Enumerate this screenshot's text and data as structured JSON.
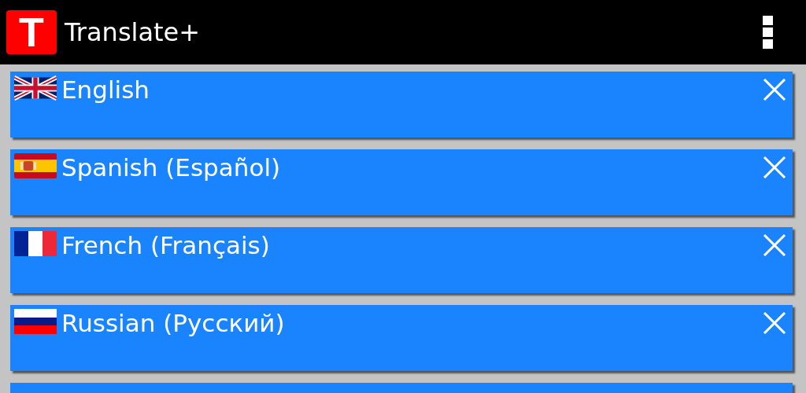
{
  "app_bar": {
    "logo": "T",
    "title": "Translate+"
  },
  "languages": [
    {
      "kind": "uk",
      "label": "English"
    },
    {
      "kind": "es",
      "label": "Spanish (Español)"
    },
    {
      "kind": "fr",
      "label": "French (Français)"
    },
    {
      "kind": "ru",
      "label": "Russian (Русский)"
    },
    {
      "kind": "blank"
    }
  ]
}
